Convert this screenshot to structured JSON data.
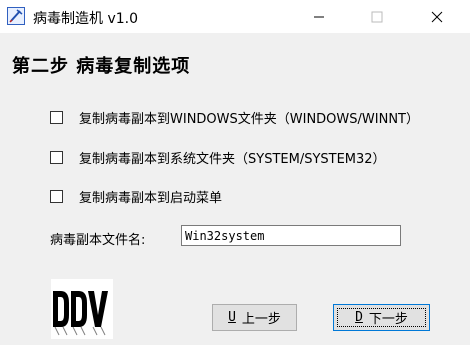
{
  "window": {
    "title": "病毒制造机 v1.0"
  },
  "heading": "第二步 病毒复制选项",
  "options": [
    {
      "label": "复制病毒副本到WINDOWS文件夹（WINDOWS/WINNT）",
      "checked": false
    },
    {
      "label": "复制病毒副本到系统文件夹（SYSTEM/SYSTEM32）",
      "checked": false
    },
    {
      "label": "复制病毒副本到启动菜单",
      "checked": false
    }
  ],
  "filename_field": {
    "label": "病毒副本文件名:",
    "value": "Win32system"
  },
  "logo_text": "DDV",
  "buttons": {
    "prev": {
      "accel": "U",
      "label": "上一步"
    },
    "next": {
      "accel": "D",
      "label": "下一步"
    }
  },
  "icons": {
    "app": "syringe-icon",
    "minimize": "minimize-icon",
    "maximize": "maximize-icon",
    "close": "close-icon"
  },
  "colors": {
    "titlebar": "#ffffff",
    "window_bg": "#f0f0f0",
    "focus_border": "#0078d7"
  }
}
